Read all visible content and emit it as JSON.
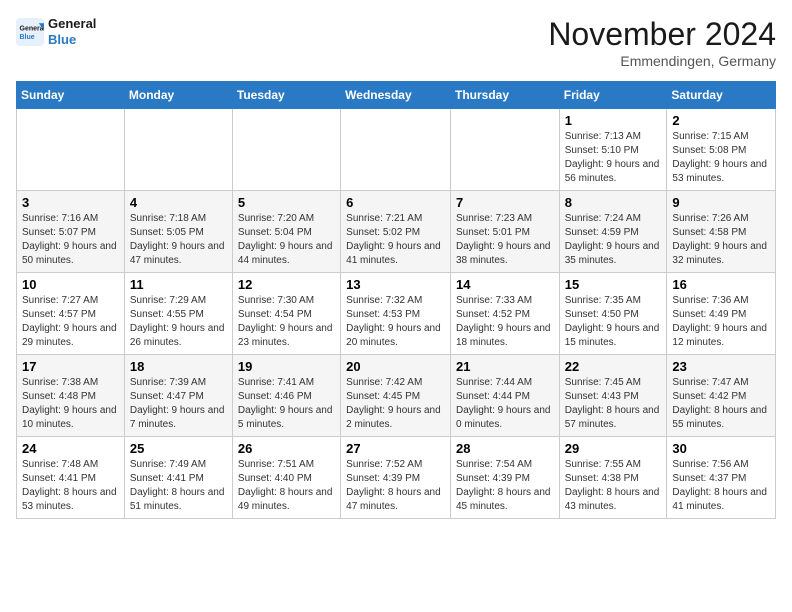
{
  "logo": {
    "line1": "General",
    "line2": "Blue"
  },
  "title": "November 2024",
  "subtitle": "Emmendingen, Germany",
  "weekdays": [
    "Sunday",
    "Monday",
    "Tuesday",
    "Wednesday",
    "Thursday",
    "Friday",
    "Saturday"
  ],
  "weeks": [
    [
      {
        "day": "",
        "info": ""
      },
      {
        "day": "",
        "info": ""
      },
      {
        "day": "",
        "info": ""
      },
      {
        "day": "",
        "info": ""
      },
      {
        "day": "",
        "info": ""
      },
      {
        "day": "1",
        "info": "Sunrise: 7:13 AM\nSunset: 5:10 PM\nDaylight: 9 hours and 56 minutes."
      },
      {
        "day": "2",
        "info": "Sunrise: 7:15 AM\nSunset: 5:08 PM\nDaylight: 9 hours and 53 minutes."
      }
    ],
    [
      {
        "day": "3",
        "info": "Sunrise: 7:16 AM\nSunset: 5:07 PM\nDaylight: 9 hours and 50 minutes."
      },
      {
        "day": "4",
        "info": "Sunrise: 7:18 AM\nSunset: 5:05 PM\nDaylight: 9 hours and 47 minutes."
      },
      {
        "day": "5",
        "info": "Sunrise: 7:20 AM\nSunset: 5:04 PM\nDaylight: 9 hours and 44 minutes."
      },
      {
        "day": "6",
        "info": "Sunrise: 7:21 AM\nSunset: 5:02 PM\nDaylight: 9 hours and 41 minutes."
      },
      {
        "day": "7",
        "info": "Sunrise: 7:23 AM\nSunset: 5:01 PM\nDaylight: 9 hours and 38 minutes."
      },
      {
        "day": "8",
        "info": "Sunrise: 7:24 AM\nSunset: 4:59 PM\nDaylight: 9 hours and 35 minutes."
      },
      {
        "day": "9",
        "info": "Sunrise: 7:26 AM\nSunset: 4:58 PM\nDaylight: 9 hours and 32 minutes."
      }
    ],
    [
      {
        "day": "10",
        "info": "Sunrise: 7:27 AM\nSunset: 4:57 PM\nDaylight: 9 hours and 29 minutes."
      },
      {
        "day": "11",
        "info": "Sunrise: 7:29 AM\nSunset: 4:55 PM\nDaylight: 9 hours and 26 minutes."
      },
      {
        "day": "12",
        "info": "Sunrise: 7:30 AM\nSunset: 4:54 PM\nDaylight: 9 hours and 23 minutes."
      },
      {
        "day": "13",
        "info": "Sunrise: 7:32 AM\nSunset: 4:53 PM\nDaylight: 9 hours and 20 minutes."
      },
      {
        "day": "14",
        "info": "Sunrise: 7:33 AM\nSunset: 4:52 PM\nDaylight: 9 hours and 18 minutes."
      },
      {
        "day": "15",
        "info": "Sunrise: 7:35 AM\nSunset: 4:50 PM\nDaylight: 9 hours and 15 minutes."
      },
      {
        "day": "16",
        "info": "Sunrise: 7:36 AM\nSunset: 4:49 PM\nDaylight: 9 hours and 12 minutes."
      }
    ],
    [
      {
        "day": "17",
        "info": "Sunrise: 7:38 AM\nSunset: 4:48 PM\nDaylight: 9 hours and 10 minutes."
      },
      {
        "day": "18",
        "info": "Sunrise: 7:39 AM\nSunset: 4:47 PM\nDaylight: 9 hours and 7 minutes."
      },
      {
        "day": "19",
        "info": "Sunrise: 7:41 AM\nSunset: 4:46 PM\nDaylight: 9 hours and 5 minutes."
      },
      {
        "day": "20",
        "info": "Sunrise: 7:42 AM\nSunset: 4:45 PM\nDaylight: 9 hours and 2 minutes."
      },
      {
        "day": "21",
        "info": "Sunrise: 7:44 AM\nSunset: 4:44 PM\nDaylight: 9 hours and 0 minutes."
      },
      {
        "day": "22",
        "info": "Sunrise: 7:45 AM\nSunset: 4:43 PM\nDaylight: 8 hours and 57 minutes."
      },
      {
        "day": "23",
        "info": "Sunrise: 7:47 AM\nSunset: 4:42 PM\nDaylight: 8 hours and 55 minutes."
      }
    ],
    [
      {
        "day": "24",
        "info": "Sunrise: 7:48 AM\nSunset: 4:41 PM\nDaylight: 8 hours and 53 minutes."
      },
      {
        "day": "25",
        "info": "Sunrise: 7:49 AM\nSunset: 4:41 PM\nDaylight: 8 hours and 51 minutes."
      },
      {
        "day": "26",
        "info": "Sunrise: 7:51 AM\nSunset: 4:40 PM\nDaylight: 8 hours and 49 minutes."
      },
      {
        "day": "27",
        "info": "Sunrise: 7:52 AM\nSunset: 4:39 PM\nDaylight: 8 hours and 47 minutes."
      },
      {
        "day": "28",
        "info": "Sunrise: 7:54 AM\nSunset: 4:39 PM\nDaylight: 8 hours and 45 minutes."
      },
      {
        "day": "29",
        "info": "Sunrise: 7:55 AM\nSunset: 4:38 PM\nDaylight: 8 hours and 43 minutes."
      },
      {
        "day": "30",
        "info": "Sunrise: 7:56 AM\nSunset: 4:37 PM\nDaylight: 8 hours and 41 minutes."
      }
    ]
  ]
}
